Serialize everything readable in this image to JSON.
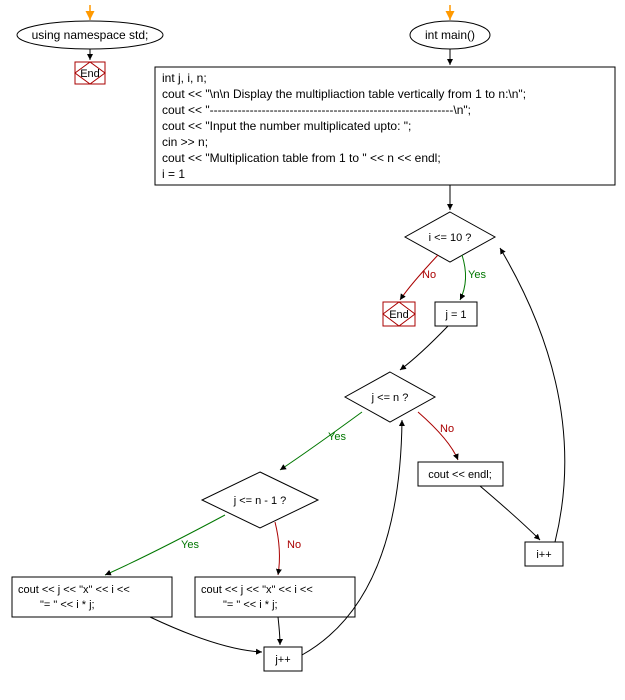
{
  "left": {
    "ellipse_text": "using namespace std;",
    "end_text": "End"
  },
  "main": {
    "ellipse_text": "int main()",
    "code_lines": [
      "int j, i, n;",
      "cout << \"\\n\\n Display the multipliaction table vertically from 1 to n:\\n\";",
      "cout << \"-------------------------------------------------------------\\n\";",
      "cout << \"Input the number multiplicated upto: \";",
      "cin >> n;",
      "cout << \"Multiplication table from 1 to \" << n << endl;",
      "i = 1"
    ],
    "decision_i": "i <= 10 ?",
    "end_text": "End",
    "j_assign": "j = 1",
    "decision_j": "j <= n ?",
    "cout_endl": "cout << endl;",
    "i_inc": "i++",
    "decision_jn1": "j <= n - 1 ?",
    "stmt_left": [
      "cout << j << \"x\" << i <<",
      "\"=  \" << i * j;"
    ],
    "stmt_right": [
      "cout << j << \"x\" << i <<",
      "\"=  \" << i * j;"
    ],
    "j_inc": "j++",
    "labels": {
      "yes": "Yes",
      "no": "No"
    }
  }
}
